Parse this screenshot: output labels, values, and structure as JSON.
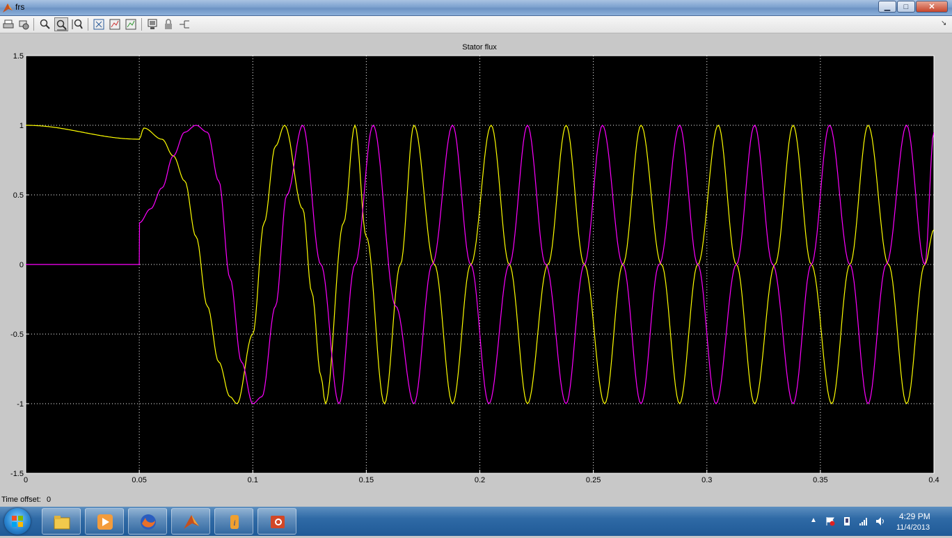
{
  "window": {
    "title": "frs"
  },
  "toolbar": {
    "items": [
      {
        "name": "print-icon"
      },
      {
        "name": "parameters-icon"
      },
      {
        "name": "zoom-icon"
      },
      {
        "name": "zoom-x-icon"
      },
      {
        "name": "zoom-y-icon"
      },
      {
        "name": "autoscale-icon"
      },
      {
        "name": "save-axes-settings-icon"
      },
      {
        "name": "restore-axes-settings-icon"
      },
      {
        "name": "floating-scope-icon"
      },
      {
        "name": "lock-axes-icon"
      },
      {
        "name": "signal-selection-icon"
      }
    ]
  },
  "scope": {
    "offset_label": "Time offset:",
    "offset_value": "0"
  },
  "chart_data": {
    "type": "line",
    "title": "Stator flux",
    "xlabel": "",
    "ylabel": "",
    "xlim": [
      0,
      0.4
    ],
    "ylim": [
      -1.5,
      1.5
    ],
    "x_ticks": [
      "0",
      "0.05",
      "0.1",
      "0.15",
      "0.2",
      "0.25",
      "0.3",
      "0.35",
      "0.4"
    ],
    "y_ticks": [
      "1.5",
      "1",
      "0.5",
      "0",
      "-0.5",
      "-1",
      "-1.5"
    ],
    "grid": true,
    "background": "#000000",
    "series": [
      {
        "color": "#ffff00",
        "x": [
          0,
          0.05,
          0.052,
          0.06,
          0.065,
          0.07,
          0.075,
          0.08,
          0.085,
          0.09,
          0.093,
          0.1,
          0.105,
          0.11,
          0.114,
          0.122,
          0.126,
          0.13,
          0.132,
          0.14,
          0.145,
          0.15,
          0.158,
          0.165,
          0.171,
          0.18,
          0.188,
          0.196,
          0.205,
          0.213,
          0.221,
          0.23,
          0.238,
          0.246,
          0.255,
          0.263,
          0.271,
          0.28,
          0.288,
          0.296,
          0.305,
          0.313,
          0.321,
          0.33,
          0.338,
          0.346,
          0.355,
          0.363,
          0.371,
          0.38,
          0.388,
          0.396,
          0.4
        ],
        "y": [
          1.0,
          0.9,
          0.98,
          0.9,
          0.78,
          0.6,
          0.2,
          -0.3,
          -0.7,
          -0.95,
          -1.0,
          -0.5,
          0.3,
          0.85,
          1.0,
          0.4,
          -0.2,
          -0.8,
          -1.0,
          0.3,
          1.0,
          0.2,
          -1.0,
          0.0,
          1.0,
          0.0,
          -1.0,
          0.0,
          1.0,
          0.0,
          -1.0,
          0.0,
          1.0,
          0.0,
          -1.0,
          0.0,
          1.0,
          0.0,
          -1.0,
          0.0,
          1.0,
          0.0,
          -1.0,
          0.0,
          1.0,
          0.0,
          -1.0,
          0.0,
          1.0,
          0.0,
          -1.0,
          0.0,
          0.25
        ]
      },
      {
        "color": "#ff00ff",
        "x": [
          0,
          0.05,
          0.0501,
          0.055,
          0.06,
          0.065,
          0.07,
          0.075,
          0.08,
          0.085,
          0.09,
          0.095,
          0.1,
          0.104,
          0.11,
          0.115,
          0.122,
          0.13,
          0.138,
          0.145,
          0.153,
          0.163,
          0.171,
          0.179,
          0.188,
          0.196,
          0.204,
          0.213,
          0.221,
          0.229,
          0.238,
          0.246,
          0.254,
          0.263,
          0.271,
          0.279,
          0.288,
          0.296,
          0.304,
          0.313,
          0.321,
          0.329,
          0.338,
          0.346,
          0.354,
          0.363,
          0.371,
          0.379,
          0.388,
          0.396,
          0.4
        ],
        "y": [
          0,
          0,
          0.3,
          0.4,
          0.55,
          0.78,
          0.95,
          1.0,
          0.95,
          0.6,
          -0.1,
          -0.7,
          -1.0,
          -0.95,
          -0.3,
          0.5,
          1.0,
          0.0,
          -1.0,
          0.0,
          1.0,
          -0.3,
          -1.0,
          0.0,
          1.0,
          0.0,
          -1.0,
          0.0,
          1.0,
          0.0,
          -1.0,
          0.0,
          1.0,
          0.0,
          -1.0,
          0.0,
          1.0,
          0.0,
          -1.0,
          0.0,
          1.0,
          0.0,
          -1.0,
          0.0,
          1.0,
          0.0,
          -1.0,
          0.0,
          1.0,
          0.0,
          0.95
        ]
      }
    ]
  },
  "taskbar": {
    "apps": [
      {
        "name": "explorer-icon",
        "color": "#f2c94c"
      },
      {
        "name": "media-player-icon",
        "color": "#f39c3c"
      },
      {
        "name": "firefox-icon",
        "color": "#e8702a"
      },
      {
        "name": "matlab-icon",
        "color": "#e05a1f"
      },
      {
        "name": "app-tool-icon",
        "color": "#f0a030"
      },
      {
        "name": "powerpoint-icon",
        "color": "#d24726"
      }
    ],
    "clock_time": "4:29 PM",
    "clock_date": "11/4/2013"
  }
}
